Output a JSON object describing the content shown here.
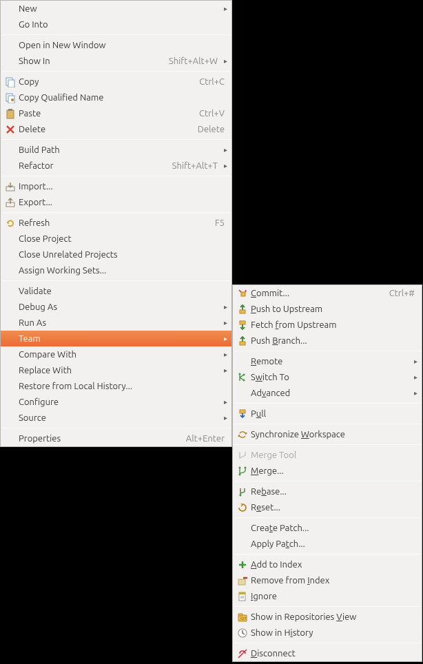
{
  "main_menu": {
    "groups": [
      [
        {
          "id": "new",
          "label": "New",
          "submenu": true
        },
        {
          "id": "go-into",
          "label": "Go Into"
        }
      ],
      [
        {
          "id": "open-new-window",
          "label": "Open in New Window"
        },
        {
          "id": "show-in",
          "label": "Show In",
          "shortcut": "Shift+Alt+W",
          "submenu": true
        }
      ],
      [
        {
          "id": "copy",
          "label": "Copy",
          "shortcut": "Ctrl+C",
          "icon": "copy"
        },
        {
          "id": "copy-qualified",
          "label": "Copy Qualified Name",
          "icon": "copy-qn"
        },
        {
          "id": "paste",
          "label": "Paste",
          "shortcut": "Ctrl+V",
          "icon": "paste"
        },
        {
          "id": "delete",
          "label": "Delete",
          "shortcut": "Delete",
          "icon": "delete"
        }
      ],
      [
        {
          "id": "build-path",
          "label": "Build Path",
          "submenu": true
        },
        {
          "id": "refactor",
          "label": "Refactor",
          "shortcut": "Shift+Alt+T",
          "submenu": true
        }
      ],
      [
        {
          "id": "import",
          "label": "Import...",
          "icon": "import"
        },
        {
          "id": "export",
          "label": "Export...",
          "icon": "export"
        }
      ],
      [
        {
          "id": "refresh",
          "label": "Refresh",
          "shortcut": "F5",
          "icon": "refresh"
        },
        {
          "id": "close-project",
          "label": "Close Project"
        },
        {
          "id": "close-unrelated",
          "label": "Close Unrelated Projects"
        },
        {
          "id": "assign-ws",
          "label": "Assign Working Sets..."
        }
      ],
      [
        {
          "id": "validate",
          "label": "Validate"
        },
        {
          "id": "debug-as",
          "label": "Debug As",
          "submenu": true
        },
        {
          "id": "run-as",
          "label": "Run As",
          "submenu": true
        },
        {
          "id": "team",
          "label": "Team",
          "submenu": true,
          "selected": true
        },
        {
          "id": "compare-with",
          "label": "Compare With",
          "submenu": true
        },
        {
          "id": "replace-with",
          "label": "Replace With",
          "submenu": true
        },
        {
          "id": "restore-local",
          "label": "Restore from Local History..."
        },
        {
          "id": "configure",
          "label": "Configure",
          "submenu": true
        },
        {
          "id": "source",
          "label": "Source",
          "submenu": true
        }
      ],
      [
        {
          "id": "properties",
          "label": "Properties",
          "shortcut": "Alt+Enter"
        }
      ]
    ]
  },
  "sub_menu": {
    "groups": [
      [
        {
          "id": "commit",
          "label": "Commit...",
          "underline": 0,
          "shortcut": "Ctrl+#",
          "icon": "commit"
        },
        {
          "id": "push-upstream",
          "label": "Push to Upstream",
          "underline": 0,
          "icon": "push"
        },
        {
          "id": "fetch-upstream",
          "label": "Fetch from Upstream",
          "underline": 6,
          "icon": "fetch"
        },
        {
          "id": "push-branch",
          "label": "Push Branch...",
          "underline": 5,
          "icon": "push"
        }
      ],
      [
        {
          "id": "remote",
          "label": "Remote",
          "underline": 0,
          "submenu": true
        },
        {
          "id": "switch-to",
          "label": "Switch To",
          "underline": 1,
          "submenu": true,
          "icon": "branches"
        },
        {
          "id": "advanced",
          "label": "Advanced",
          "underline": 2,
          "submenu": true
        }
      ],
      [
        {
          "id": "pull",
          "label": "Pull",
          "underline": 1,
          "icon": "pull"
        }
      ],
      [
        {
          "id": "sync-workspace",
          "label": "Synchronize Workspace",
          "underline": 12,
          "icon": "sync"
        }
      ],
      [
        {
          "id": "merge-tool",
          "label": "Merge Tool",
          "disabled": true,
          "icon": "merge-tool"
        },
        {
          "id": "merge",
          "label": "Merge...",
          "underline": 0,
          "icon": "merge"
        }
      ],
      [
        {
          "id": "rebase",
          "label": "Rebase...",
          "underline": 2,
          "icon": "rebase"
        },
        {
          "id": "reset",
          "label": "Reset...",
          "underline": 1,
          "icon": "reset"
        }
      ],
      [
        {
          "id": "create-patch",
          "label": "Create Patch...",
          "underline": 4
        },
        {
          "id": "apply-patch",
          "label": "Apply Patch...",
          "underline": 8
        }
      ],
      [
        {
          "id": "add-index",
          "label": "Add to Index",
          "underline": 0,
          "icon": "add"
        },
        {
          "id": "remove-index",
          "label": "Remove from Index",
          "underline": 12,
          "icon": "remove"
        },
        {
          "id": "ignore",
          "label": "Ignore",
          "underline": 0,
          "icon": "ignore"
        }
      ],
      [
        {
          "id": "show-repo-view",
          "label": "Show in Repositories View",
          "underline": 21,
          "icon": "repo"
        },
        {
          "id": "show-history",
          "label": "Show in History",
          "underline": 9,
          "icon": "history"
        }
      ],
      [
        {
          "id": "disconnect",
          "label": "Disconnect",
          "underline": 0,
          "icon": "disconnect"
        }
      ]
    ]
  },
  "icons": {
    "copy": "copy-icon",
    "copy-qn": "copy-qualified-icon",
    "paste": "paste-icon",
    "delete": "delete-icon",
    "import": "import-icon",
    "export": "export-icon",
    "refresh": "refresh-icon",
    "commit": "commit-icon",
    "push": "push-icon",
    "fetch": "fetch-icon",
    "branches": "branches-icon",
    "pull": "pull-icon",
    "sync": "sync-icon",
    "merge-tool": "merge-tool-icon",
    "merge": "merge-icon",
    "rebase": "rebase-icon",
    "reset": "reset-icon",
    "add": "add-icon",
    "remove": "remove-icon",
    "ignore": "ignore-icon",
    "repo": "repo-icon",
    "history": "history-icon",
    "disconnect": "disconnect-icon"
  }
}
